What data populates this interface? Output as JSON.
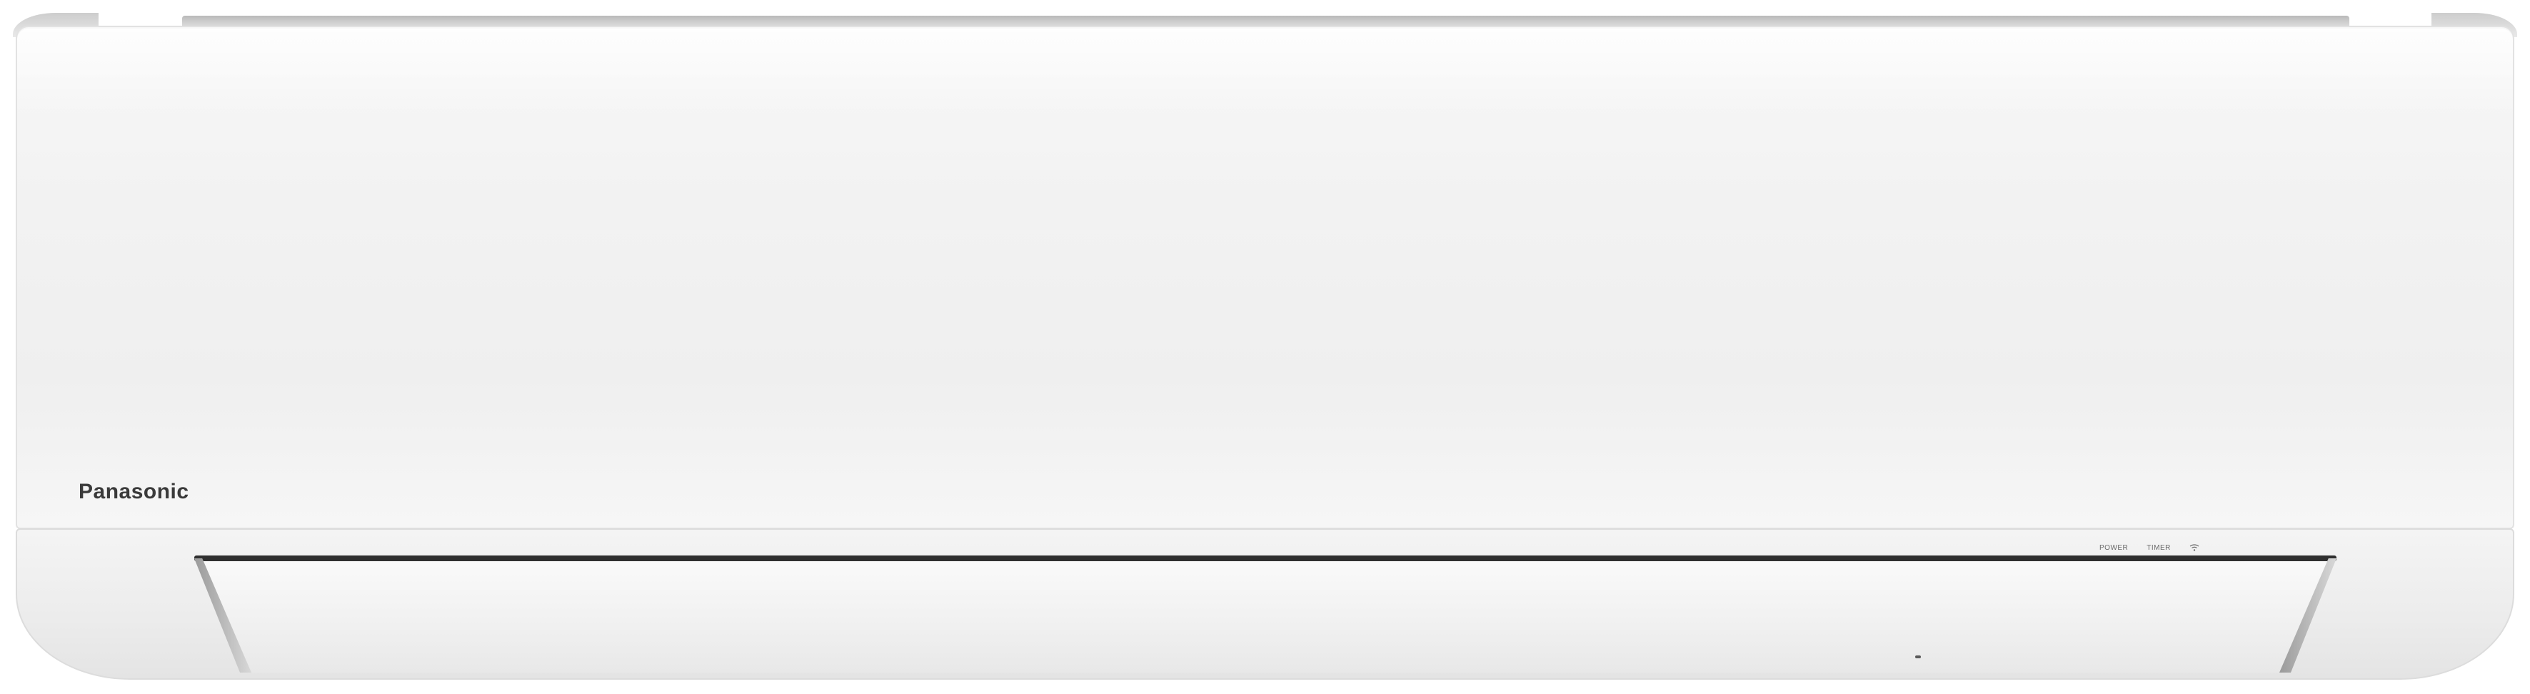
{
  "brand": {
    "name": "Panasonic"
  },
  "indicators": {
    "power_label": "POWER",
    "timer_label": "TIMER",
    "wifi_icon": "wifi-icon"
  },
  "colors": {
    "body": "#f2f2f2",
    "brand_text": "#3a3a3a",
    "top_strip": "#c4c4c4",
    "louver_edge": "#2f2f2f"
  }
}
